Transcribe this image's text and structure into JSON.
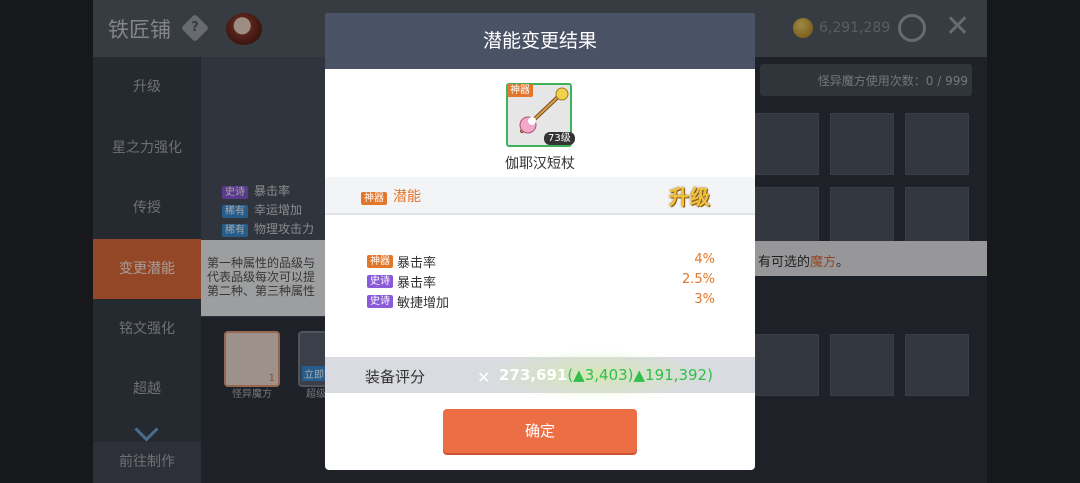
{
  "header": {
    "title": "铁匠铺",
    "coins": "6,291,289"
  },
  "sidebar": {
    "items": [
      {
        "label": "升级"
      },
      {
        "label": "星之力强化"
      },
      {
        "label": "传授"
      },
      {
        "label": "变更潜能"
      },
      {
        "label": "铭文强化"
      },
      {
        "label": "超越"
      }
    ],
    "active": "变更潜能",
    "footer": "前往制作"
  },
  "background": {
    "use_count": "怪异魔方使用次数：0 / 999",
    "option_list": [
      {
        "tag": "史诗",
        "text": "暴击率"
      },
      {
        "tag": "稀有",
        "text": "幸运增加"
      },
      {
        "tag": "稀有",
        "text": "物理攻击力"
      }
    ],
    "desc_lines": [
      "第一种属性的品级与",
      "代表品级每次可以提",
      "第二种、第三种属性"
    ],
    "hint_prefix": "有可选的",
    "hint_accent": "魔方",
    "hint_suffix": "。",
    "items": [
      {
        "label": "怪异魔方",
        "count": "1"
      },
      {
        "label": "超级",
        "tag": "立即"
      }
    ]
  },
  "modal": {
    "title": "潜能变更结果",
    "item": {
      "tag": "神器",
      "level": "73级",
      "name": "伽耶汉短杖"
    },
    "section": {
      "tag": "神器",
      "title": "潜能",
      "badge": "升级"
    },
    "attributes": [
      {
        "tag": "神器",
        "name": "暴击率",
        "value": "4%"
      },
      {
        "tag": "史诗",
        "name": "暴击率",
        "value": "2.5%"
      },
      {
        "tag": "史诗",
        "name": "敏捷增加",
        "value": "3%"
      }
    ],
    "score": {
      "label": "装备评分",
      "value": "273,691",
      "delta_open": "(▲3,403)",
      "delta2": "▲191,392)"
    },
    "confirm_label": "确定"
  },
  "colors": {
    "accent": "#e46d3c",
    "modal_header": "#4a5265",
    "confirm": "#ec6e44",
    "positive": "#2fbf4a"
  }
}
